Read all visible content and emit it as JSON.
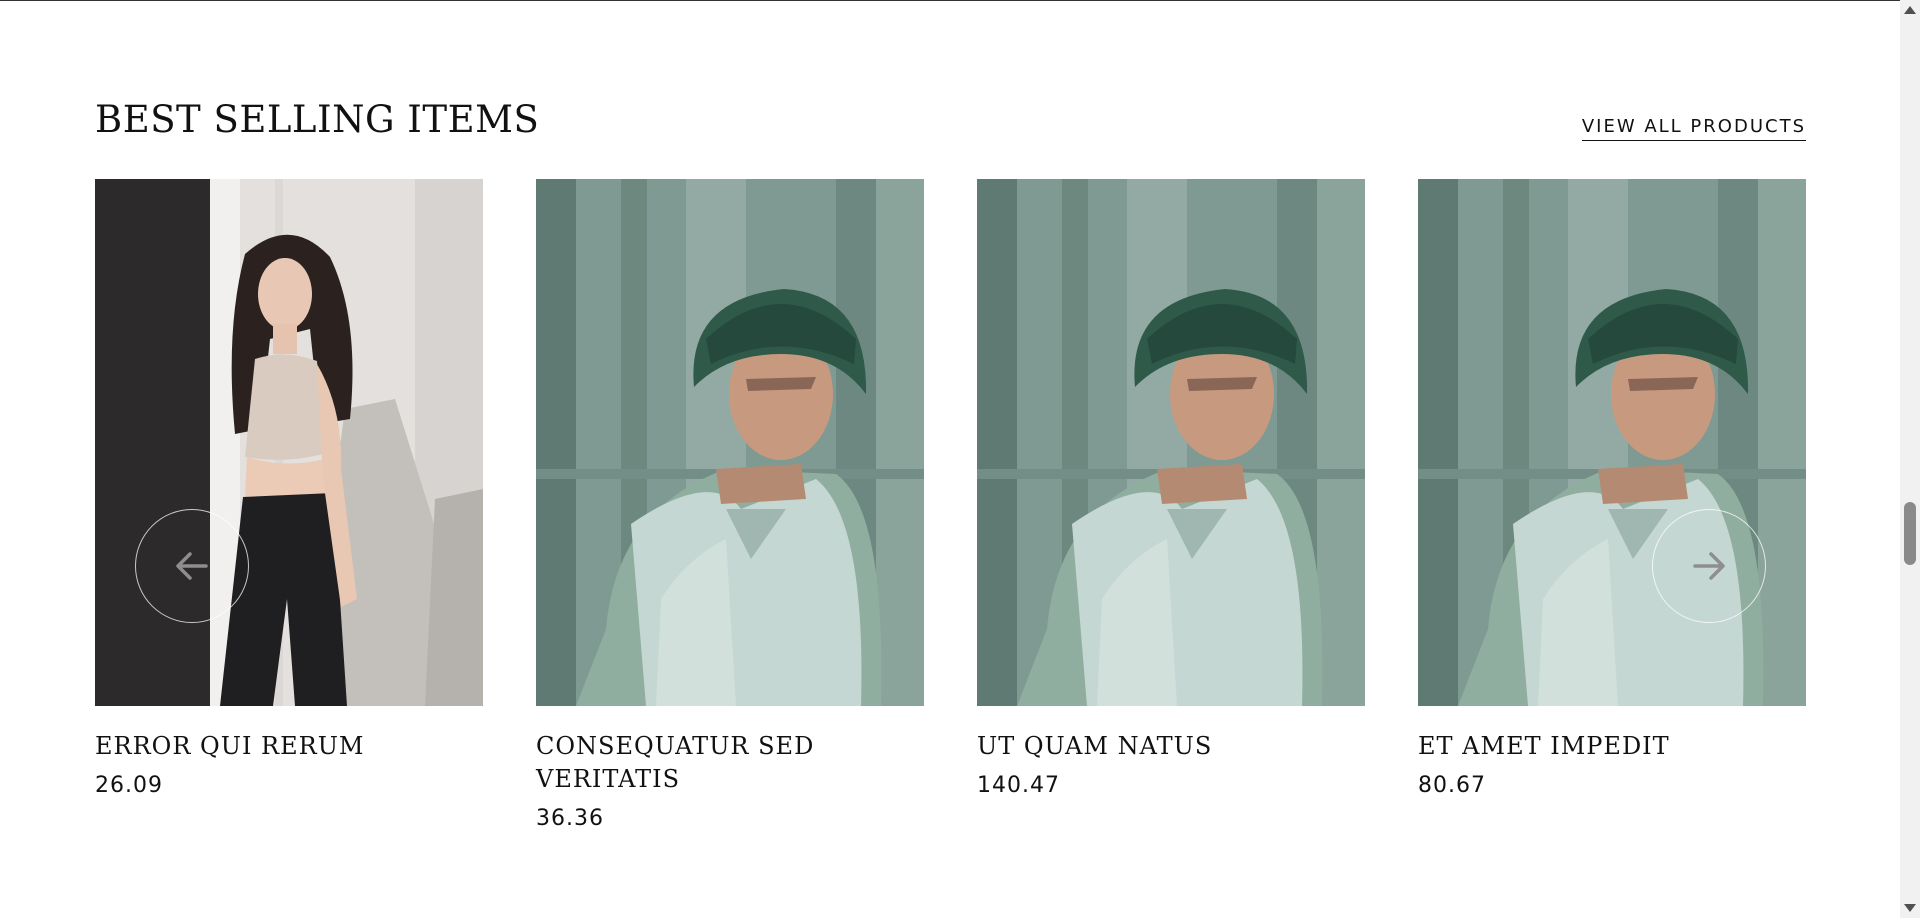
{
  "section": {
    "title": "BEST SELLING ITEMS",
    "view_all_label": "VIEW ALL PRODUCTS"
  },
  "products": [
    {
      "name": "ERROR QUI RERUM",
      "price": "26.09"
    },
    {
      "name": "CONSEQUATUR SED VERITATIS",
      "price": "36.36"
    },
    {
      "name": "UT QUAM NATUS",
      "price": "140.47"
    },
    {
      "name": "ET AMET IMPEDIT",
      "price": "80.67"
    }
  ],
  "carousel": {
    "prev_icon": "arrow-left-icon",
    "next_icon": "arrow-right-icon"
  },
  "colors": {
    "text": "#111111",
    "background": "#ffffff",
    "photo_teal": "#7e9a92",
    "hat_green": "#2f5a4a"
  }
}
